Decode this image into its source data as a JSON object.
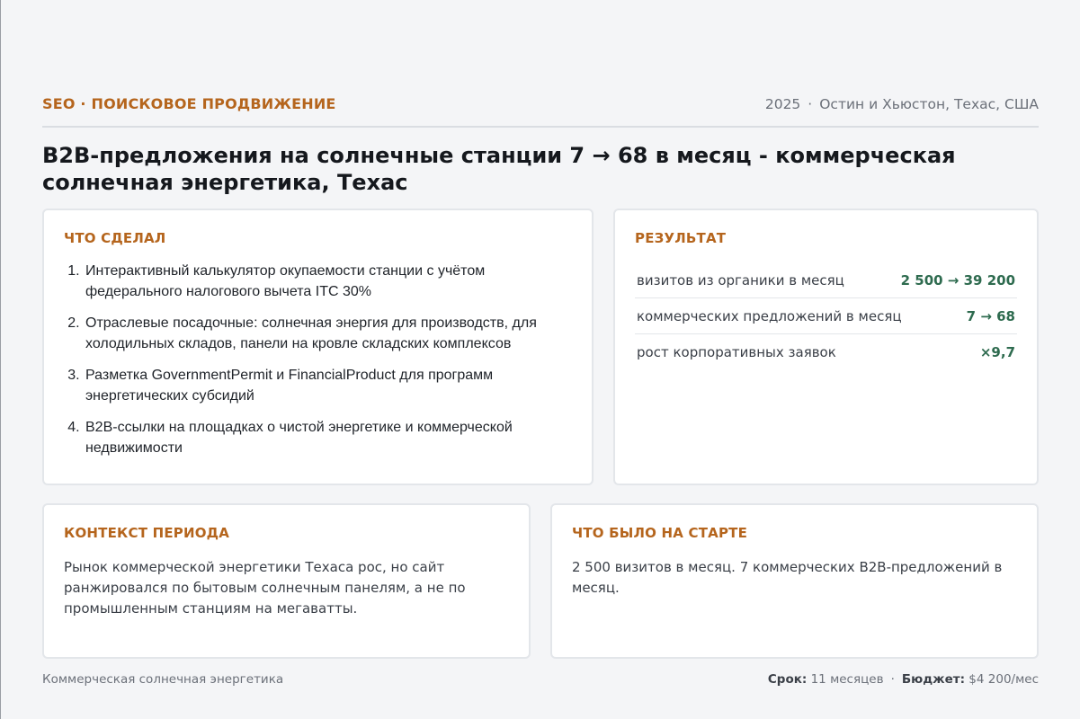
{
  "header": {
    "kicker": "SEO · ПОИСКОВОЕ ПРОДВИЖЕНИЕ",
    "year": "2025",
    "location": "Остин и Хьюстон, Техас, США"
  },
  "title": "B2B-предложения на солнечные станции 7 → 68 в месяц - коммерческая солнечная энергетика, Техас",
  "done": {
    "title": "ЧТО СДЕЛАЛ",
    "items": [
      "Интерактивный калькулятор окупаемости станции с учётом федерального налогового вычета ITC 30%",
      "Отраслевые посадочные: солнечная энергия для производств, для холодильных складов, панели на кровле складских комплексов",
      "Разметка GovernmentPermit и FinancialProduct для программ энергетических субсидий",
      "B2B-ссылки на площадках о чистой энергетике и коммерческой недвижимости"
    ]
  },
  "result": {
    "title": "РЕЗУЛЬТАТ",
    "metrics": [
      {
        "label": "визитов из органики в месяц",
        "value": "2 500 → 39 200"
      },
      {
        "label": "коммерческих предложений в месяц",
        "value": "7 → 68"
      },
      {
        "label": "рост корпоративных заявок",
        "value": "×9,7"
      }
    ]
  },
  "context": {
    "title": "КОНТЕКСТ ПЕРИОДА",
    "text": "Рынок коммерческой энергетики Техаса рос, но сайт ранжировался по бытовым солнечным панелям, а не по промышленным станциям на мегаватты."
  },
  "start": {
    "title": "ЧТО БЫЛО НА СТАРТЕ",
    "text": "2 500 визитов в месяц. 7 коммерческих B2B-предложений в месяц."
  },
  "footer": {
    "category": "Коммерческая солнечная энергетика",
    "term_label": "Срок:",
    "term_value": "11 месяцев",
    "budget_label": "Бюджет:",
    "budget_value": "$4 200/мес"
  },
  "colors": {
    "accent": "#b5651d",
    "positive": "#2e6b4f",
    "background": "#f4f5f7"
  }
}
